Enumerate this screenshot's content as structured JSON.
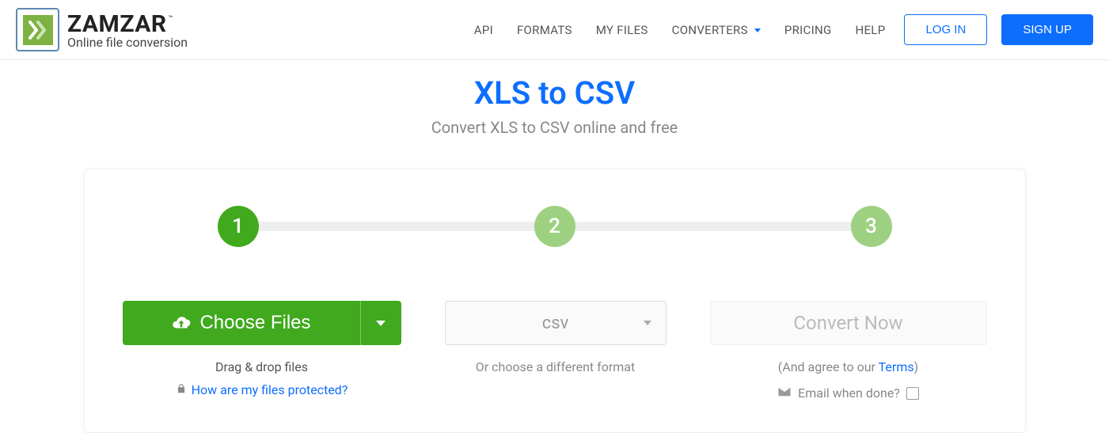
{
  "brand": {
    "name": "ZAMZAR",
    "tm": "™",
    "tagline": "Online file conversion"
  },
  "nav": {
    "api": "API",
    "formats": "FORMATS",
    "myfiles": "MY FILES",
    "converters": "CONVERTERS",
    "pricing": "PRICING",
    "help": "HELP",
    "login": "LOG IN",
    "signup": "SIGN UP"
  },
  "page": {
    "title": "XLS to CSV",
    "subtitle": "Convert XLS to CSV online and free"
  },
  "steps": {
    "s1": "1",
    "s2": "2",
    "s3": "3"
  },
  "step1": {
    "choose": "Choose Files",
    "dragdrop": "Drag & drop files",
    "protect": "How are my files protected?"
  },
  "step2": {
    "format": "csv",
    "hint": "Or choose a different format"
  },
  "step3": {
    "convert": "Convert Now",
    "agree_prefix": "(And agree to our ",
    "terms": "Terms",
    "agree_suffix": ")",
    "email": "Email when done?"
  }
}
